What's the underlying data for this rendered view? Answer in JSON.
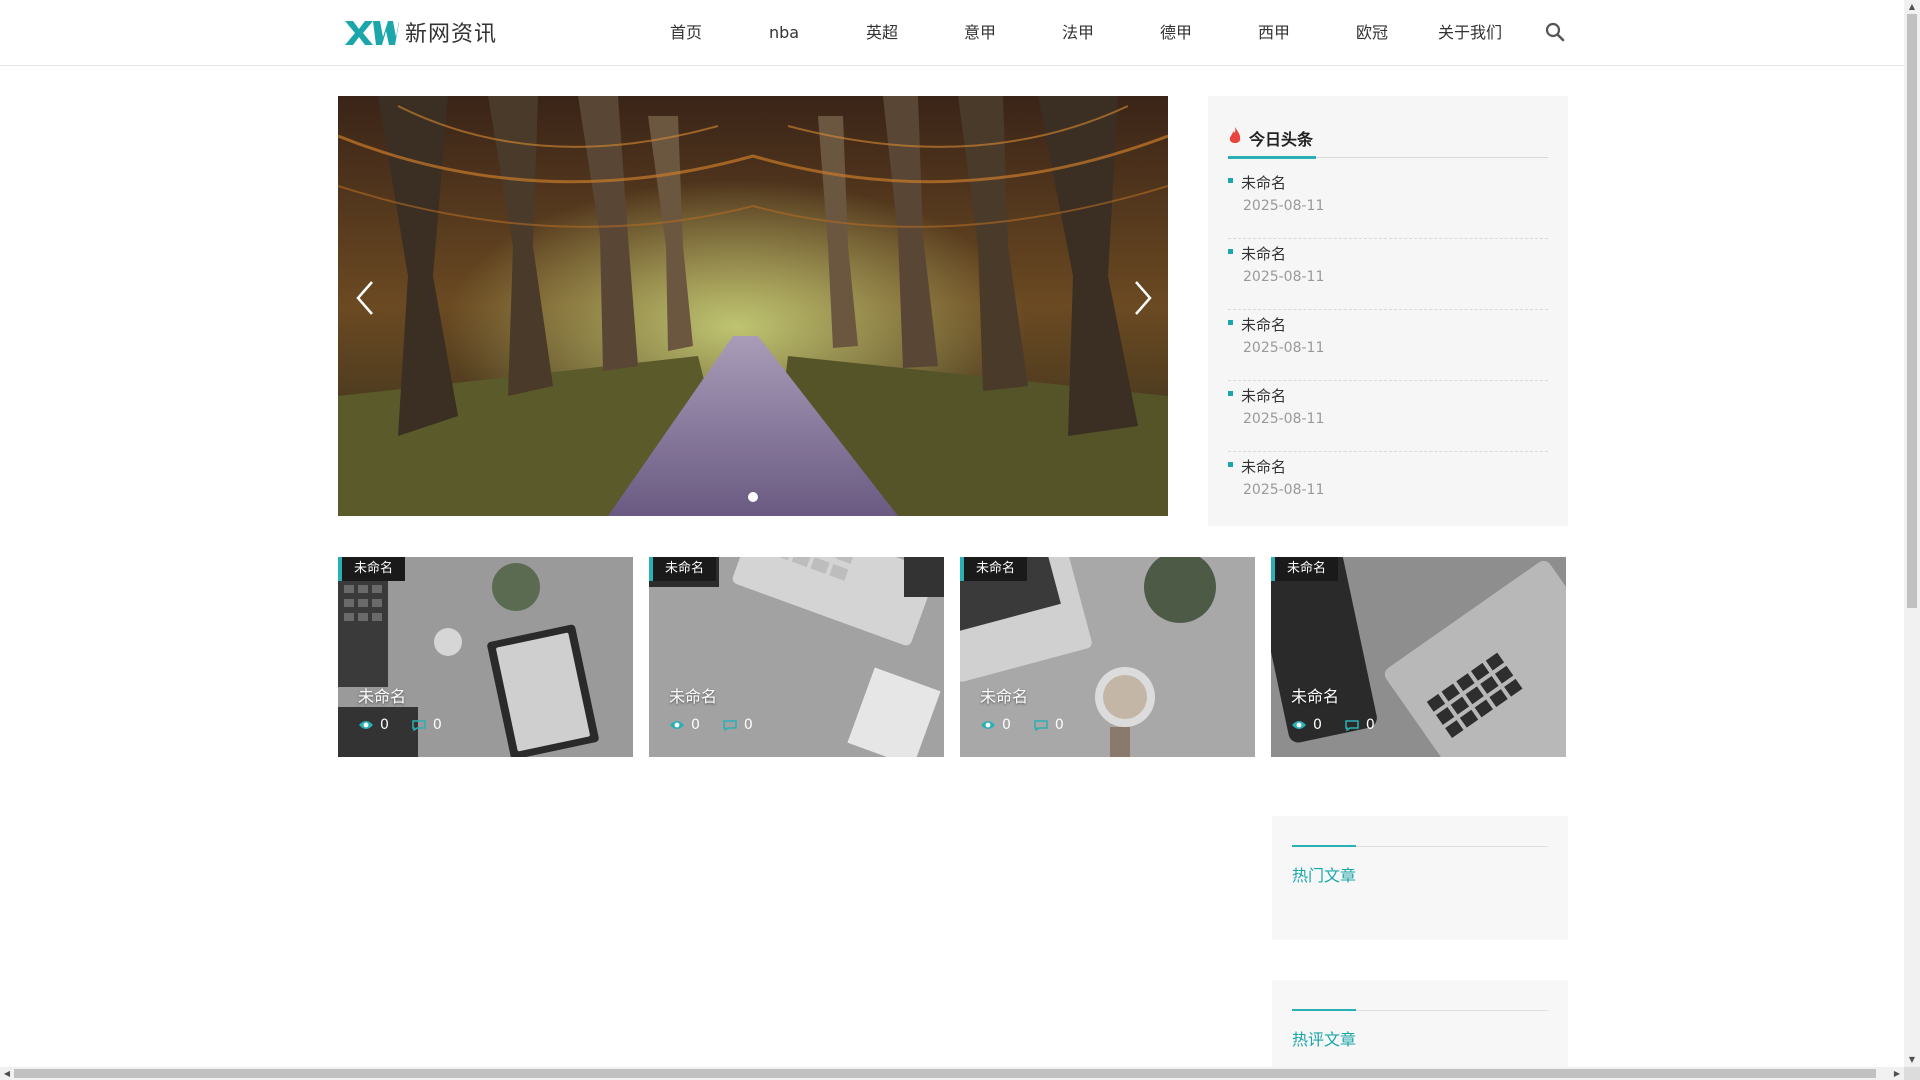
{
  "header": {
    "logo_mark": "XW",
    "logo_text": "新网资讯",
    "nav": [
      "首页",
      "nba",
      "英超",
      "意甲",
      "法甲",
      "德甲",
      "西甲",
      "欧冠",
      "关于我们"
    ],
    "search_icon": "search-icon"
  },
  "slider": {
    "active_slide": 1,
    "slide_count": 1
  },
  "headlines": {
    "title": "今日头条",
    "items": [
      {
        "title": "未命名",
        "date": "2025-08-11"
      },
      {
        "title": "未命名",
        "date": "2025-08-11"
      },
      {
        "title": "未命名",
        "date": "2025-08-11"
      },
      {
        "title": "未命名",
        "date": "2025-08-11"
      },
      {
        "title": "未命名",
        "date": "2025-08-11"
      }
    ]
  },
  "cards": [
    {
      "tag": "未命名",
      "title": "未命名",
      "views": "0",
      "comments": "0"
    },
    {
      "tag": "未命名",
      "title": "未命名",
      "views": "0",
      "comments": "0"
    },
    {
      "tag": "未命名",
      "title": "未命名",
      "views": "0",
      "comments": "0"
    },
    {
      "tag": "未命名",
      "title": "未命名",
      "views": "0",
      "comments": "0"
    }
  ],
  "side": {
    "hot_title": "热门文章",
    "comment_title": "热评文章"
  },
  "colors": {
    "accent": "#2ab0b4",
    "accent_dark": "#1aa6aa",
    "flame": "#e8453c"
  }
}
